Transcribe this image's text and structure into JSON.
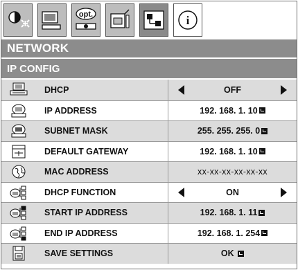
{
  "tabs": [
    {
      "icon": "picture-adjust-icon",
      "active": false
    },
    {
      "icon": "image-settings-icon",
      "active": false
    },
    {
      "icon": "option-icon",
      "label": "opt.",
      "active": false
    },
    {
      "icon": "installation-icon",
      "active": false
    },
    {
      "icon": "network-icon",
      "active": true
    },
    {
      "icon": "info-icon",
      "label": "i",
      "active": false
    }
  ],
  "header": {
    "section": "NETWORK",
    "subsection": "IP CONFIG"
  },
  "rows": [
    {
      "icon": "dhcp-icon",
      "label": "DHCP",
      "value": "OFF",
      "type": "select"
    },
    {
      "icon": "ip-address-icon",
      "label": "IP ADDRESS",
      "value": "192. 168. 1. 10",
      "type": "enter"
    },
    {
      "icon": "subnet-mask-icon",
      "label": "SUBNET MASK",
      "value": "255. 255. 255. 0",
      "type": "enter"
    },
    {
      "icon": "default-gateway-icon",
      "label": "DEFAULT GATEWAY",
      "value": "192. 168. 1. 10",
      "type": "enter"
    },
    {
      "icon": "mac-address-icon",
      "label": "MAC ADDRESS",
      "value": "xx-xx-xx-xx-xx-xx",
      "type": "readonly"
    },
    {
      "icon": "dhcp-function-icon",
      "label": "DHCP FUNCTION",
      "value": "ON",
      "type": "select"
    },
    {
      "icon": "start-ip-icon",
      "label": "START IP ADDRESS",
      "value": "192. 168. 1. 11",
      "type": "enter"
    },
    {
      "icon": "end-ip-icon",
      "label": "END IP ADDRESS",
      "value": "192. 168. 1. 254",
      "type": "enter"
    },
    {
      "icon": "save-icon",
      "label": "SAVE SETTINGS",
      "value": "OK",
      "type": "enter"
    }
  ]
}
